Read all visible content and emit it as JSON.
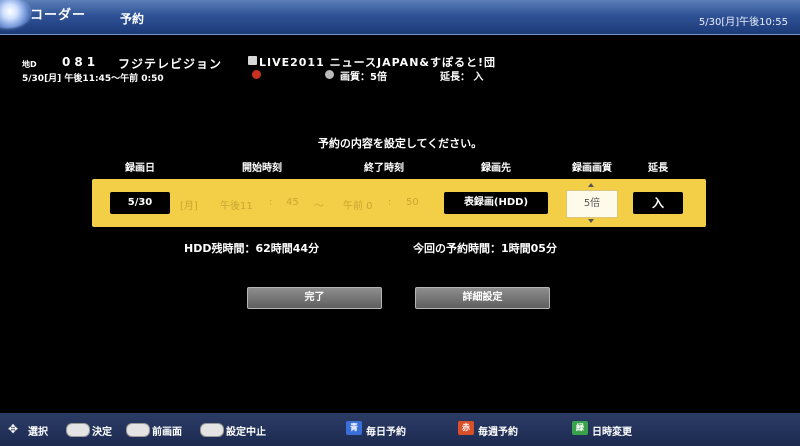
{
  "header": {
    "app_name": "コーダー",
    "screen_title": "予約",
    "datetime": "5/30[月]午後10:55"
  },
  "program": {
    "channel_type": "地D",
    "channel_number": "081",
    "channel_name": "フジテレビジョン",
    "airtime": "5/30[月] 午後11:45〜午前 0:50",
    "title": "LIVE2011 ニュースJAPAN&すぽると!団",
    "quality_text": "画質：5倍",
    "extension_text": "延長： 入"
  },
  "form": {
    "instruction": "予約の内容を設定してください。",
    "headers": {
      "date": "録画日",
      "start": "開始時刻",
      "end": "終了時刻",
      "destination": "録画先",
      "quality": "録画画質",
      "extension": "延長"
    },
    "date_value": "5/30",
    "weekday": "[月]",
    "start_ampm": "午後11",
    "start_colon": ":",
    "start_min": "45",
    "tilde": "〜",
    "end_ampm": "午前 0",
    "end_colon": ":",
    "end_min": "50",
    "destination_value": "表録画(HDD)",
    "quality_value": "5倍",
    "extension_value": "入"
  },
  "status": {
    "hdd_remaining": "HDD残時間：62時間44分",
    "this_reservation": "今回の予約時間：1時間05分"
  },
  "buttons": {
    "done": "完了",
    "details": "詳細設定"
  },
  "footer": {
    "select": "選択",
    "confirm": "決定",
    "prev": "前画面",
    "cancel": "設定中止",
    "daily": "毎日予約",
    "weekly": "毎週予約",
    "datetime_change": "日時変更",
    "blue_key": "青",
    "red_key": "赤",
    "green_key": "緑",
    "colors": {
      "blue": "#3b6fd8",
      "red": "#d8502a",
      "green": "#3aa24a"
    }
  }
}
